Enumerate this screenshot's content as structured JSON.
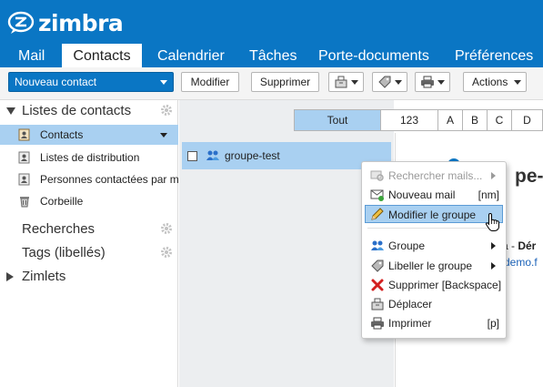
{
  "app": {
    "logo_text": "zimbra"
  },
  "tabs": [
    {
      "label": "Mail"
    },
    {
      "label": "Contacts",
      "active": true
    },
    {
      "label": "Calendrier"
    },
    {
      "label": "Tâches"
    },
    {
      "label": "Porte-documents"
    },
    {
      "label": "Préférences"
    }
  ],
  "toolbar": {
    "new_contact": "Nouveau contact",
    "edit": "Modifier",
    "delete": "Supprimer",
    "actions": "Actions"
  },
  "sidebar": {
    "lists_header": "Listes de contacts",
    "items": [
      {
        "label": "Contacts",
        "selected": true
      },
      {
        "label": "Listes de distribution"
      },
      {
        "label": "Personnes contactées par m"
      },
      {
        "label": "Corbeille"
      }
    ],
    "searches": "Recherches",
    "tags": "Tags (libellés)",
    "zimlets": "Zimlets"
  },
  "alpha_filter": [
    "Tout",
    "123",
    "A",
    "B",
    "C",
    "D"
  ],
  "alpha_active": "Tout",
  "list": {
    "row_label": "groupe-test"
  },
  "detail": {
    "title": "pe-t",
    "subtitle_part": "a - ",
    "subtitle_bold": "Dér",
    "link": "demo.f"
  },
  "context_menu": {
    "search_mails": "Rechercher mails...",
    "new_mail": "Nouveau mail",
    "new_mail_shortcut": "[nm]",
    "edit_group": "Modifier le groupe",
    "group": "Groupe",
    "tag_group": "Libeller le groupe",
    "delete": "Supprimer [Backspace]",
    "move": "Déplacer",
    "print": "Imprimer",
    "print_shortcut": "[p]"
  },
  "colors": {
    "brand": "#0a76c4",
    "selection": "#a9d0f1"
  }
}
